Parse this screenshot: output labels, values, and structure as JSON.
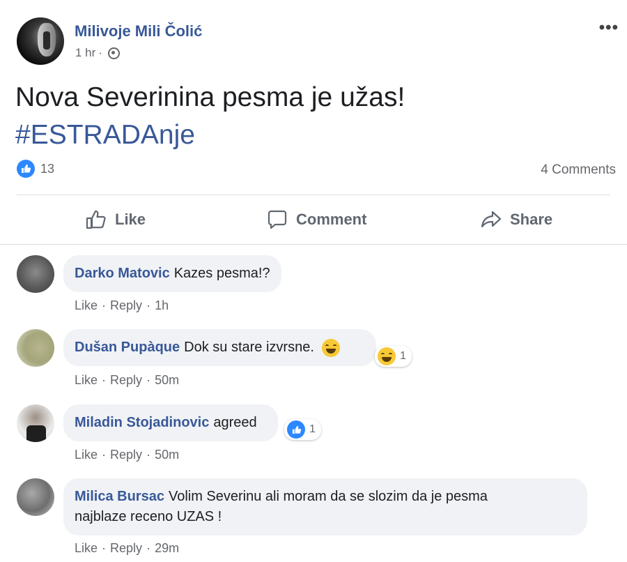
{
  "post": {
    "author": "Milivoje Mili Čolić",
    "time": "1 hr",
    "more_label": "•••",
    "text_line1": "Nova Severinina pesma je užas!",
    "hashtag": "#ESTRADAnje",
    "reaction_count": "13",
    "comments_count": "4 Comments"
  },
  "actions": {
    "like": "Like",
    "comment": "Comment",
    "share": "Share"
  },
  "comments": [
    {
      "name": "Darko Matovic",
      "text": "Kazes pesma!?",
      "like": "Like",
      "reply": "Reply",
      "time": "1h"
    },
    {
      "name": "Dušan Pupàque",
      "text": "Dok su stare izvrsne.",
      "like": "Like",
      "reply": "Reply",
      "time": "50m",
      "reaction_count": "1"
    },
    {
      "name": "Miladin Stojadinovic",
      "text": "agreed",
      "like": "Like",
      "reply": "Reply",
      "time": "50m",
      "reaction_count": "1"
    },
    {
      "name": "Milica Bursac",
      "text_line1": "Volim Severinu ali moram da se slozim da je pesma",
      "text_line2": "najblaze receno UZAS !",
      "like": "Like",
      "reply": "Reply",
      "time": "29m"
    }
  ],
  "separator": "·",
  "colors": {
    "link": "#385898",
    "like_blue": "#2d88ff",
    "bubble": "#f0f2f5",
    "muted": "#65676b"
  },
  "icons": [
    "globe-icon",
    "thumbs-up-icon",
    "comment-bubble-icon",
    "share-arrow-icon",
    "laugh-emoji-icon"
  ]
}
